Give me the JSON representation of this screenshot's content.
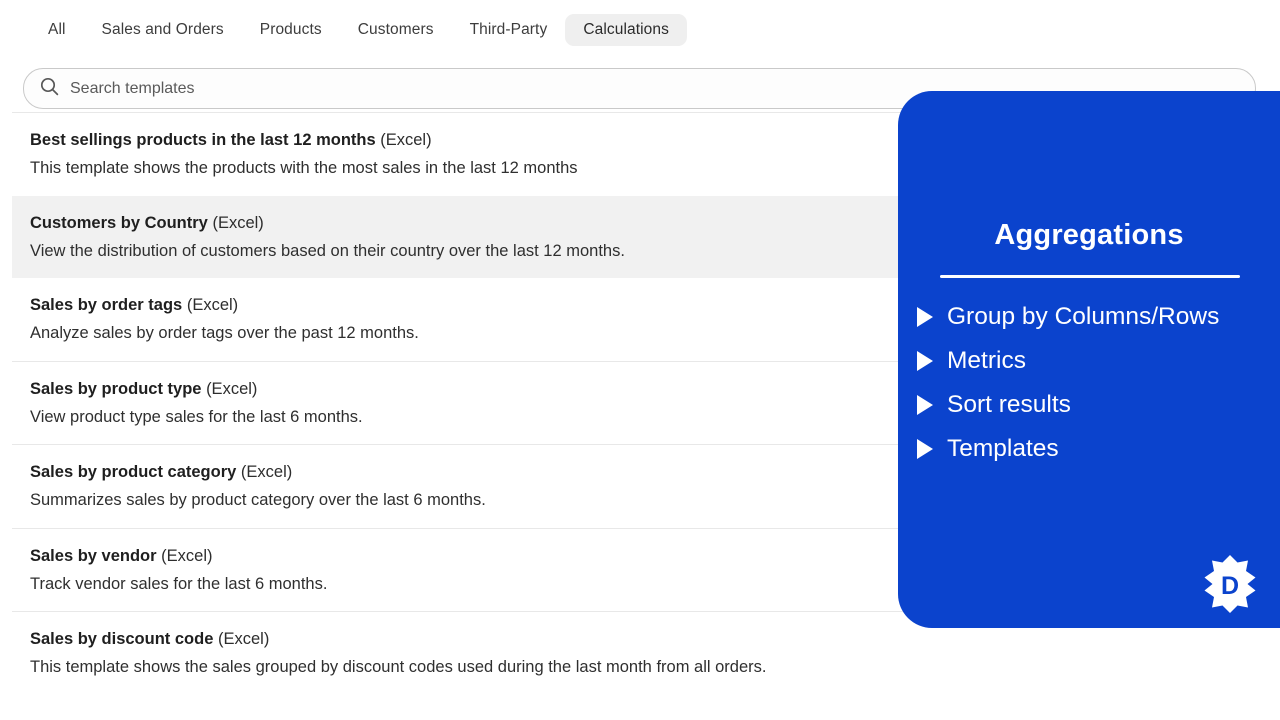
{
  "tabs": [
    {
      "label": "All",
      "active": false
    },
    {
      "label": "Sales and Orders",
      "active": false
    },
    {
      "label": "Products",
      "active": false
    },
    {
      "label": "Customers",
      "active": false
    },
    {
      "label": "Third-Party",
      "active": false
    },
    {
      "label": "Calculations",
      "active": true
    }
  ],
  "search": {
    "placeholder": "Search templates",
    "value": "",
    "icon": "search-icon"
  },
  "templates": [
    {
      "name": "Best sellings products in the last 12 months",
      "format": "(Excel)",
      "description": "This template shows the products with the most sales in the last 12 months",
      "selected": false
    },
    {
      "name": "Customers by Country",
      "format": "(Excel)",
      "description": "View the distribution of customers based on their country over the last 12 months.",
      "selected": true
    },
    {
      "name": "Sales by order tags",
      "format": "(Excel)",
      "description": "Analyze sales by order tags over the past 12 months.",
      "selected": false
    },
    {
      "name": "Sales by product type",
      "format": "(Excel)",
      "description": "View product type sales for the last 6 months.",
      "selected": false
    },
    {
      "name": "Sales by product category",
      "format": "(Excel)",
      "description": "Summarizes sales by product category over the last 6 months.",
      "selected": false
    },
    {
      "name": "Sales by vendor",
      "format": "(Excel)",
      "description": "Track vendor sales for the last 6 months.",
      "selected": false
    },
    {
      "name": "Sales by discount code",
      "format": "(Excel)",
      "description": "This template shows the sales grouped by discount codes used during the last month from all orders.",
      "selected": false
    }
  ],
  "panel": {
    "title": "Aggregations",
    "accent_color": "#0b43cd",
    "text_color": "#ffffff",
    "items": [
      {
        "label": "Group by Columns/Rows",
        "icon": "caret-right-icon"
      },
      {
        "label": "Metrics",
        "icon": "caret-right-icon"
      },
      {
        "label": "Sort results",
        "icon": "caret-right-icon"
      },
      {
        "label": "Templates",
        "icon": "caret-right-icon"
      }
    ],
    "logo": {
      "letter": "D",
      "icon": "app-logo-icon"
    }
  }
}
